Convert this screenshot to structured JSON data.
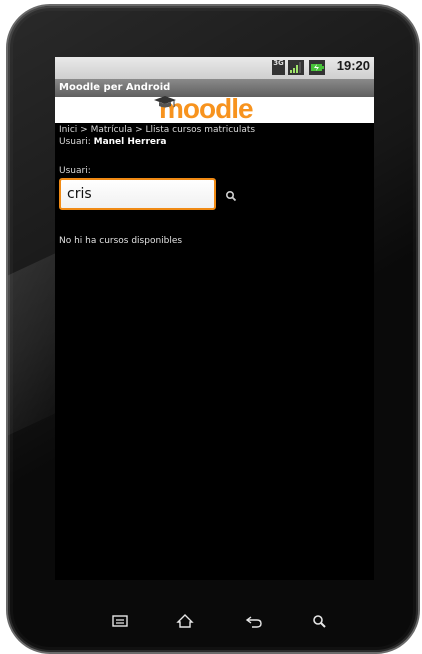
{
  "status_bar": {
    "network": "3G",
    "time": "19:20"
  },
  "app": {
    "title": "Moodle per Android",
    "logo_text": "moodle"
  },
  "breadcrumb": "Inici > Matrícula > Llista cursos matriculats",
  "user": {
    "prefix": "Usuari:",
    "name": "Manel Herrera"
  },
  "search": {
    "label": "Usuari:",
    "value": "cris"
  },
  "results": {
    "empty_message": "No hi ha cursos disponibles"
  },
  "colors": {
    "accent": "#f08a14",
    "logo": "#f7931e"
  },
  "nav_icons": [
    "menu-icon",
    "home-icon",
    "back-icon",
    "search-icon"
  ]
}
